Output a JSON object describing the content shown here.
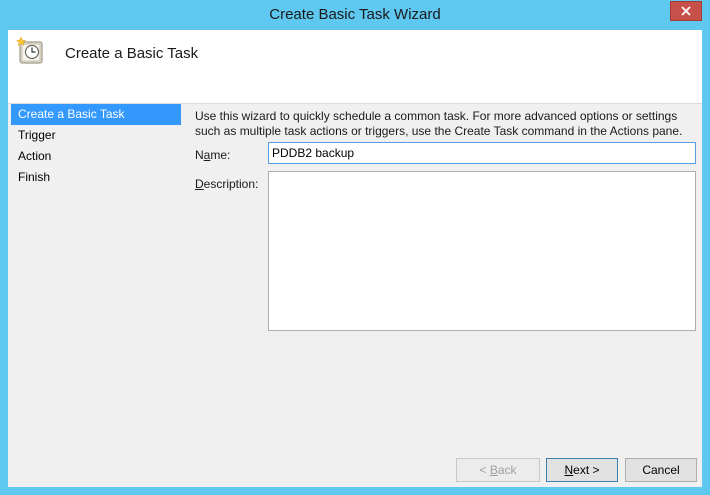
{
  "window": {
    "title": "Create Basic Task Wizard",
    "close_glyph": "✕"
  },
  "header": {
    "icon": "task-scheduler-clock-icon",
    "title": "Create a Basic Task"
  },
  "nav": {
    "items": [
      {
        "label": "Create a Basic Task",
        "active": true
      },
      {
        "label": "Trigger",
        "active": false
      },
      {
        "label": "Action",
        "active": false
      },
      {
        "label": "Finish",
        "active": false
      }
    ]
  },
  "main": {
    "intro_line1": "Use this wizard to quickly schedule a common task.  For more advanced options or settings",
    "intro_line2": "such as multiple task actions or triggers, use the Create Task command in the Actions pane.",
    "name_label_pre": "N",
    "name_label_underlined": "a",
    "name_label_post": "me:",
    "name_value": "PDDB2 backup",
    "description_label_underlined": "D",
    "description_label_post": "escription:",
    "description_value": ""
  },
  "buttons": {
    "back_pre": "< ",
    "back_underlined": "B",
    "back_post": "ack",
    "next_underlined": "N",
    "next_post": "ext >",
    "cancel": "Cancel"
  },
  "colors": {
    "title_bar": "#5ec8f0",
    "selection": "#3399ff",
    "close_button": "#c7504a"
  }
}
